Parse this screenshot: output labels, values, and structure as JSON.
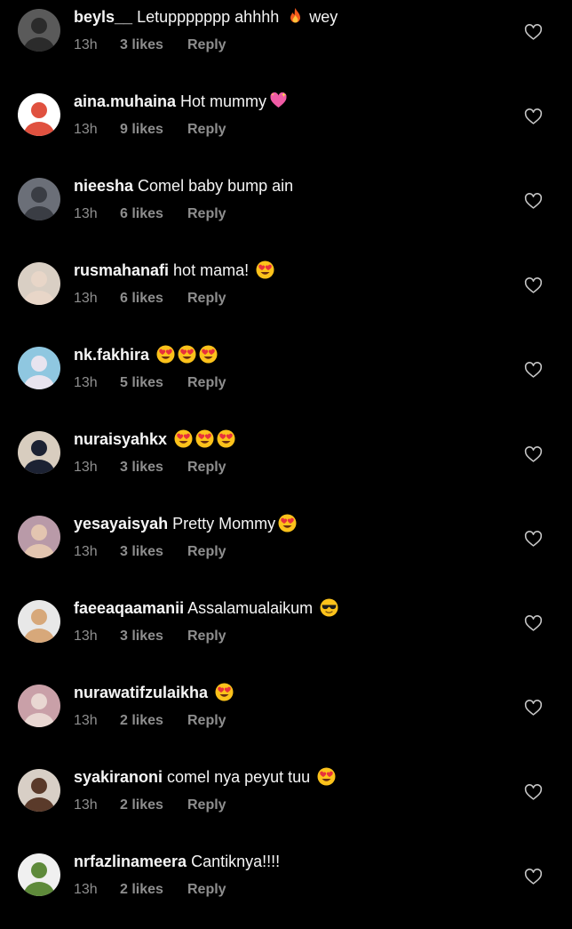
{
  "comments": [
    {
      "username": "beyls__",
      "text": " Letuppppppp ahhhh ",
      "emojis": [
        "fire"
      ],
      "text_after": " wey",
      "time": "13h",
      "likes": "3 likes",
      "reply": "Reply",
      "avatar_colors": [
        "#5a5a5a",
        "#2b2b2b"
      ]
    },
    {
      "username": "aina.muhaina",
      "text": " Hot mummy",
      "emojis": [
        "sparkling-heart"
      ],
      "text_after": "",
      "time": "13h",
      "likes": "9 likes",
      "reply": "Reply",
      "avatar_colors": [
        "#ffffff",
        "#e0513f"
      ]
    },
    {
      "username": "nieesha",
      "text": " Comel baby bump ain",
      "emojis": [],
      "text_after": "",
      "time": "13h",
      "likes": "6 likes",
      "reply": "Reply",
      "avatar_colors": [
        "#6b6f78",
        "#3a3d44"
      ]
    },
    {
      "username": "rusmahanafi",
      "text": " hot mama! ",
      "emojis": [
        "heart-eyes"
      ],
      "text_after": "",
      "time": "13h",
      "likes": "6 likes",
      "reply": "Reply",
      "avatar_colors": [
        "#d9cfc4",
        "#e8d6c8"
      ]
    },
    {
      "username": "nk.fakhira",
      "text": " ",
      "emojis": [
        "heart-eyes",
        "heart-eyes",
        "heart-eyes"
      ],
      "text_after": "",
      "time": "13h",
      "likes": "5 likes",
      "reply": "Reply",
      "avatar_colors": [
        "#8fc7e0",
        "#e8e4ef"
      ]
    },
    {
      "username": "nuraisyahkx",
      "text": " ",
      "emojis": [
        "heart-eyes",
        "heart-eyes",
        "heart-eyes"
      ],
      "text_after": "",
      "time": "13h",
      "likes": "3 likes",
      "reply": "Reply",
      "avatar_colors": [
        "#d8cdbf",
        "#1c2233"
      ]
    },
    {
      "username": "yesayaisyah",
      "text": " Pretty Mommy",
      "emojis": [
        "heart-eyes"
      ],
      "text_after": "",
      "time": "13h",
      "likes": "3 likes",
      "reply": "Reply",
      "avatar_colors": [
        "#b99aa8",
        "#e3c5b0"
      ]
    },
    {
      "username": "faeeaqaamanii",
      "text": " Assalamualaikum ",
      "emojis": [
        "sunglasses"
      ],
      "text_after": "",
      "time": "13h",
      "likes": "3 likes",
      "reply": "Reply",
      "avatar_colors": [
        "#e8e8e8",
        "#d7a87a"
      ]
    },
    {
      "username": "nurawatifzulaikha",
      "text": " ",
      "emojis": [
        "heart-eyes"
      ],
      "text_after": "",
      "time": "13h",
      "likes": "2 likes",
      "reply": "Reply",
      "avatar_colors": [
        "#c9a0a8",
        "#e9d7d2"
      ]
    },
    {
      "username": "syakiranoni",
      "text": " comel nya peyut tuu ",
      "emojis": [
        "heart-eyes"
      ],
      "text_after": "",
      "time": "13h",
      "likes": "2 likes",
      "reply": "Reply",
      "avatar_colors": [
        "#d8cfc6",
        "#5a3a2a"
      ]
    },
    {
      "username": "nrfazlinameera",
      "text": " Cantiknya!!!!",
      "emojis": [],
      "text_after": "",
      "time": "13h",
      "likes": "2 likes",
      "reply": "Reply",
      "avatar_colors": [
        "#f0f0f0",
        "#5e8a3a"
      ]
    }
  ],
  "colors": {
    "background": "#000000",
    "primary_text": "#f5f5f5",
    "secondary_text": "#8e8e8e"
  }
}
